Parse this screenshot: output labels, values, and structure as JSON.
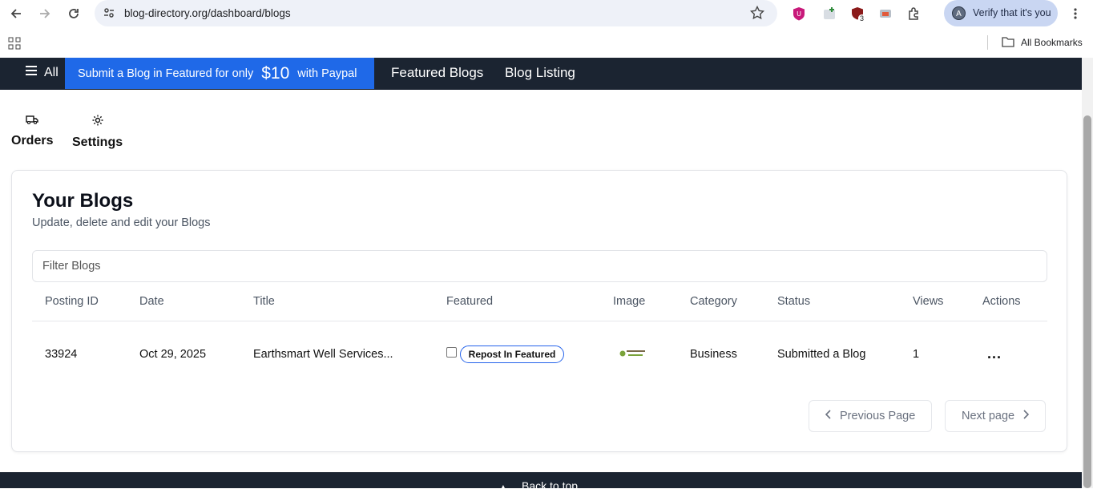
{
  "browser": {
    "url": "blog-directory.org/dashboard/blogs",
    "profile_label": "Verify that it's you",
    "profile_initial": "A",
    "bookmarks_label": "All Bookmarks",
    "ext_badge": "3"
  },
  "site_nav": {
    "all_label": "All",
    "promo_prefix": "Submit a Blog in Featured for only",
    "promo_price": "$10",
    "promo_suffix": "with Paypal",
    "links": [
      "Featured Blogs",
      "Blog Listing"
    ]
  },
  "dashboard_tabs": [
    {
      "label": "Orders",
      "icon": "truck-icon"
    },
    {
      "label": "Settings",
      "icon": "gear-icon"
    }
  ],
  "card": {
    "title": "Your Blogs",
    "subtitle": "Update, delete and edit your Blogs",
    "filter_placeholder": "Filter Blogs"
  },
  "table": {
    "headers": [
      "Posting ID",
      "Date",
      "Title",
      "Featured",
      "Image",
      "Category",
      "Status",
      "Views",
      "Actions"
    ],
    "rows": [
      {
        "posting_id": "33924",
        "date": "Oct 29, 2025",
        "title": "Earthsmart Well Services...",
        "featured_checked": false,
        "featured_button": "Repost In Featured",
        "image_alt": "EARTHSMART WELL SERVICES",
        "category": "Business",
        "status": "Submitted a Blog",
        "views": "1",
        "actions": "..."
      }
    ]
  },
  "pagination": {
    "prev": "Previous Page",
    "next": "Next page"
  },
  "footer": {
    "back_to_top": "Back to top"
  },
  "colors": {
    "nav_bg": "#1b2431",
    "promo_bg": "#1f69e8",
    "pill_border": "#2563eb"
  }
}
